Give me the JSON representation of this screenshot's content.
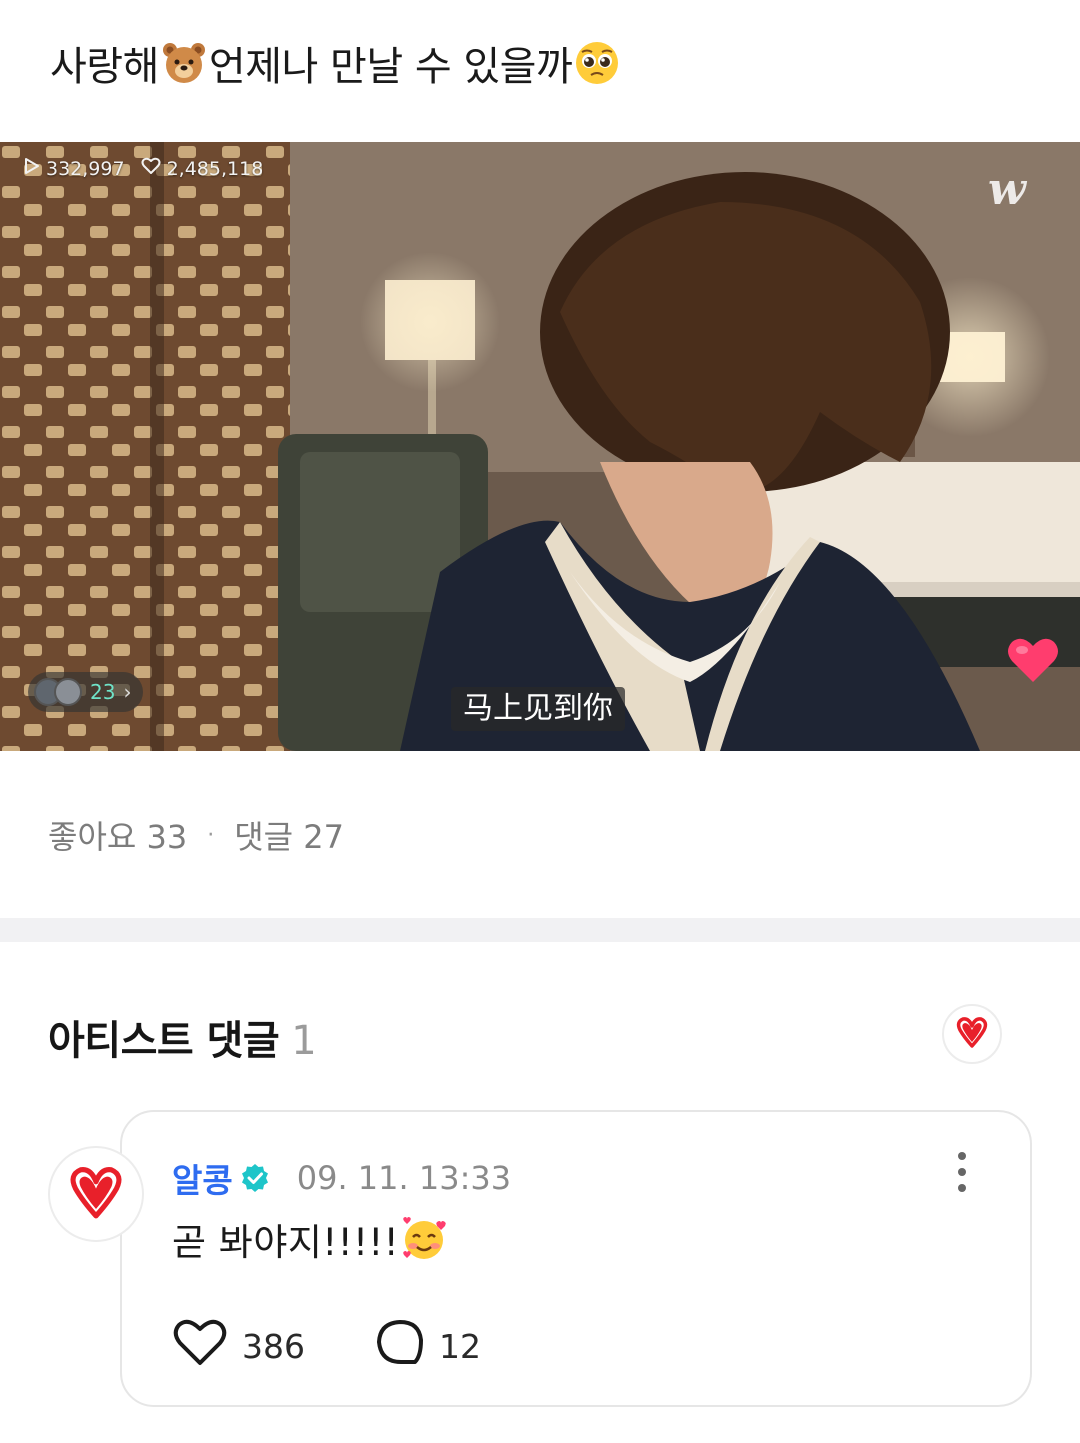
{
  "post": {
    "title_part1": "사랑해",
    "title_emoji1": "bear-face-emoji",
    "title_part2": "언제나 만날 수 있을까",
    "title_emoji2": "pleading-face-emoji"
  },
  "video": {
    "play_count": "332,997",
    "like_count": "2,485,118",
    "watermark": "w",
    "viewer_count": "23",
    "subtitle": "马上见到你",
    "heart_color": "#ff3d6e"
  },
  "stats": {
    "likes": "좋아요 33",
    "separator": "·",
    "comments": "댓글 27"
  },
  "artist_comments": {
    "heading": "아티스트 댓글",
    "count": "1"
  },
  "comment": {
    "author": "알콩",
    "verified_color": "#1ec5c9",
    "timestamp": "09. 11. 13:33",
    "text": "곧 봐야지!!!!!",
    "text_emoji": "smiling-face-with-hearts-emoji",
    "like_count": "386",
    "reply_count": "12"
  },
  "colors": {
    "accent_blue": "#2e6cf0",
    "badge_red": "#e8202a",
    "muted_text": "#7c7c7c"
  }
}
